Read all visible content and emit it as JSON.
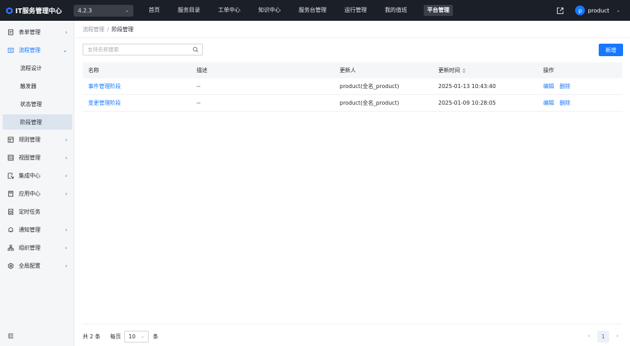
{
  "app": {
    "title": "IT服务管理中心",
    "version": "4.2.3"
  },
  "nav": {
    "items": [
      {
        "label": "首页",
        "active": false
      },
      {
        "label": "服务目录",
        "active": false
      },
      {
        "label": "工单中心",
        "active": false
      },
      {
        "label": "知识中心",
        "active": false
      },
      {
        "label": "服务台管理",
        "active": false
      },
      {
        "label": "运行管理",
        "active": false
      },
      {
        "label": "我的值班",
        "active": false
      },
      {
        "label": "平台管理",
        "active": true
      }
    ]
  },
  "user": {
    "avatar_letter": "p",
    "name": "product"
  },
  "sidebar": {
    "items": [
      {
        "label": "表单管理",
        "icon": "form-icon"
      },
      {
        "label": "流程管理",
        "icon": "process-icon",
        "open": true
      },
      {
        "label": "流程设计"
      },
      {
        "label": "触发器"
      },
      {
        "label": "状态管理"
      },
      {
        "label": "阶段管理",
        "selected": true
      },
      {
        "label": "规则管理",
        "icon": "rule-icon"
      },
      {
        "label": "视图管理",
        "icon": "view-icon"
      },
      {
        "label": "集成中心",
        "icon": "integration-icon"
      },
      {
        "label": "应用中心",
        "icon": "app-icon"
      },
      {
        "label": "定时任务",
        "icon": "schedule-icon"
      },
      {
        "label": "通知管理",
        "icon": "bell-icon"
      },
      {
        "label": "组织管理",
        "icon": "org-icon"
      },
      {
        "label": "全局配置",
        "icon": "settings-icon"
      }
    ]
  },
  "breadcrumb": {
    "parent": "流程管理",
    "separator": "/",
    "current": "阶段管理"
  },
  "search": {
    "placeholder": "支持名称搜索",
    "value": ""
  },
  "toolbar": {
    "add_label": "新增"
  },
  "table": {
    "headers": {
      "name": "名称",
      "description": "描述",
      "updater": "更新人",
      "updated_at": "更新时间",
      "actions": "操作"
    },
    "rows": [
      {
        "name": "事件管理阶段",
        "description": "--",
        "updater": "product(全名_product)",
        "updated_at": "2025-01-13 10:43:40",
        "edit": "编辑",
        "delete": "删除"
      },
      {
        "name": "变更管理阶段",
        "description": "--",
        "updater": "product(全名_product)",
        "updated_at": "2025-01-09 10:28:05",
        "edit": "编辑",
        "delete": "删除"
      }
    ]
  },
  "pagination": {
    "total_text": "共 2 条",
    "per_page_label": "每页",
    "page_size": "10",
    "unit": "条",
    "current_page": "1",
    "prev": "‹",
    "next": "›"
  },
  "colors": {
    "primary": "#1677ff",
    "topbar": "#1b1f27",
    "sidebar_bg": "#f5f6f7",
    "selected_bg": "#dce4f0"
  }
}
